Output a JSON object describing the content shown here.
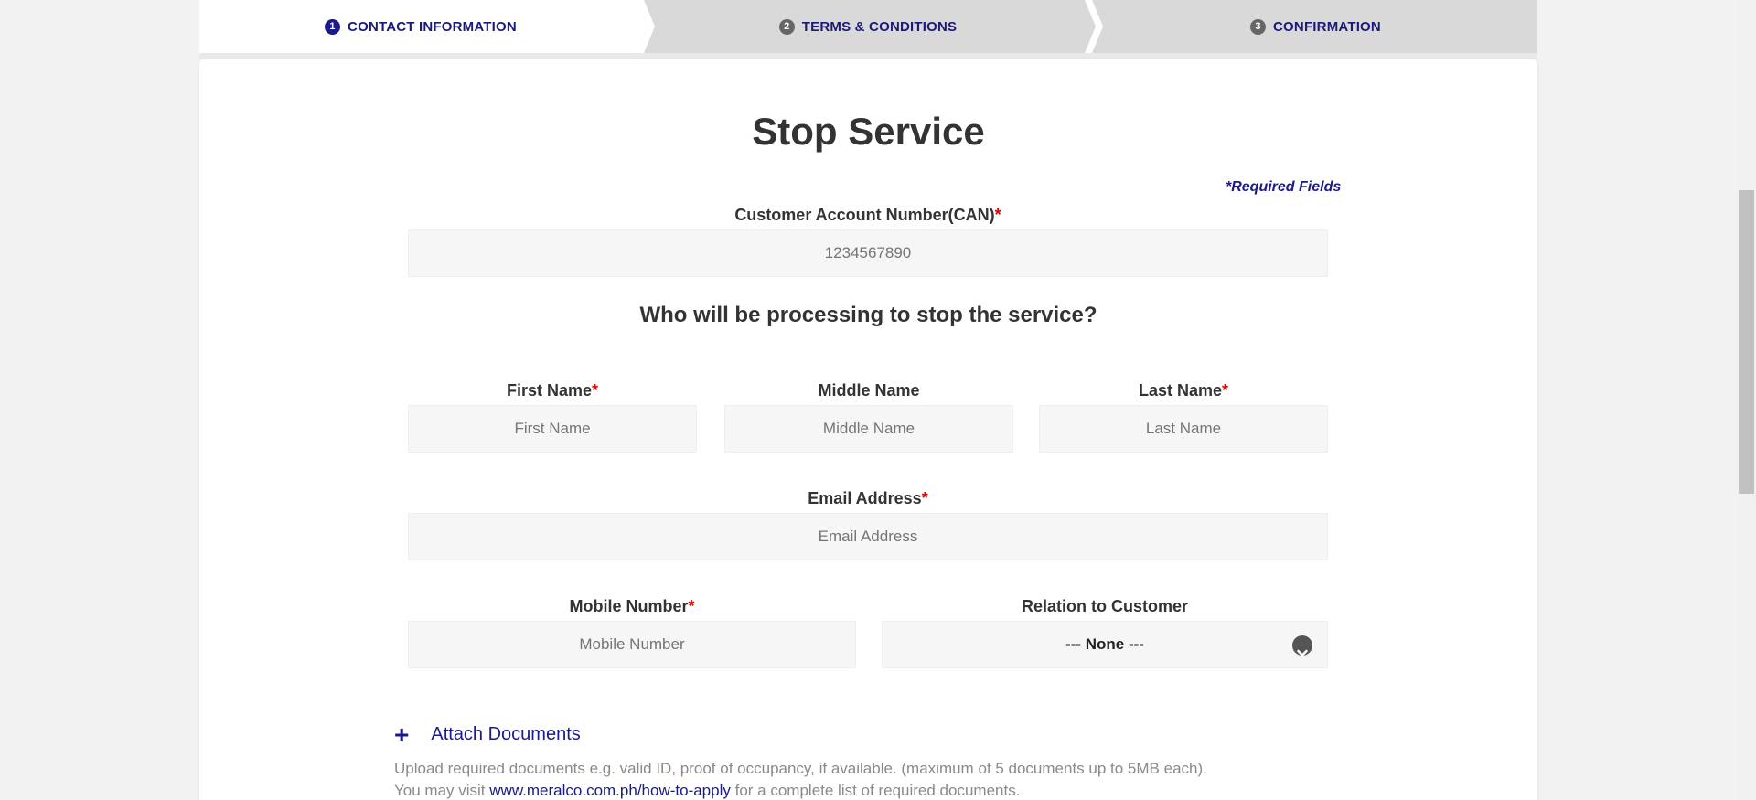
{
  "stepper": {
    "steps": [
      {
        "number": "1",
        "label": "CONTACT INFORMATION"
      },
      {
        "number": "2",
        "label": "TERMS & CONDITIONS"
      },
      {
        "number": "3",
        "label": "CONFIRMATION"
      }
    ]
  },
  "form": {
    "title": "Stop Service",
    "required_note": "*Required Fields",
    "can": {
      "label": "Customer Account Number(CAN)",
      "required_mark": "*",
      "placeholder": "1234567890"
    },
    "question": "Who will be processing to stop the service?",
    "first_name": {
      "label": "First Name",
      "required_mark": "*",
      "placeholder": "First Name"
    },
    "middle_name": {
      "label": "Middle Name",
      "placeholder": "Middle Name"
    },
    "last_name": {
      "label": "Last Name",
      "required_mark": "*",
      "placeholder": "Last Name"
    },
    "email": {
      "label": "Email Address",
      "required_mark": "*",
      "placeholder": "Email Address"
    },
    "mobile": {
      "label": "Mobile Number",
      "required_mark": "*",
      "placeholder": "Mobile Number"
    },
    "relation": {
      "label": "Relation to Customer",
      "selected": "--- None ---"
    },
    "attach": {
      "plus_icon": "plus-icon",
      "label": "Attach Documents",
      "help_line1": "Upload required documents e.g. valid ID, proof of occupancy, if available. (maximum of 5 documents up to 5MB each).",
      "help_line2_prefix": "You may visit",
      "help_link": "www.meralco.com.ph/how-to-apply",
      "help_line2_suffix": "for a complete list of required documents."
    }
  },
  "colors": {
    "brand_navy": "#1a1a8c",
    "required_red": "#e00000",
    "input_bg": "#f6f6f6",
    "stepper_bg": "#d9d9d9"
  }
}
